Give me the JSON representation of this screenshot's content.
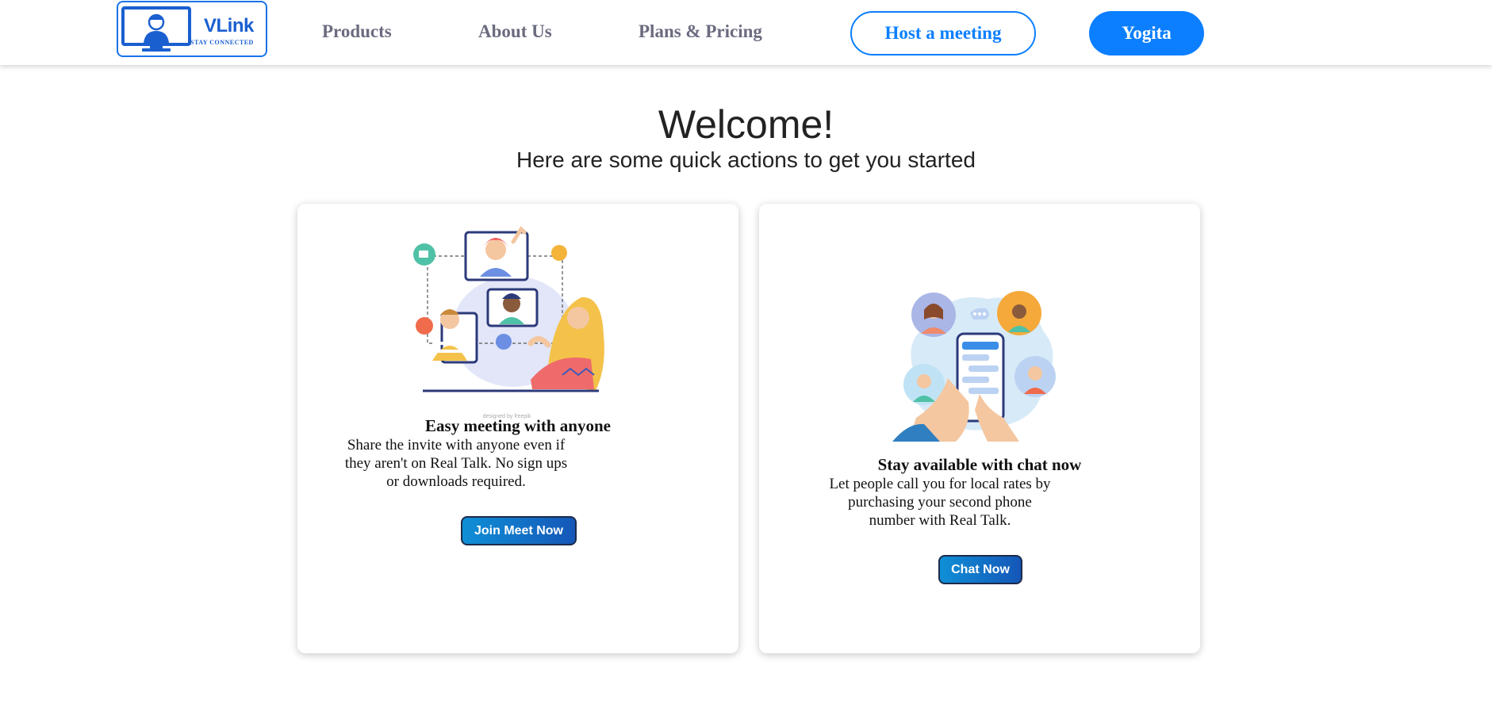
{
  "logo": {
    "name": "VLink",
    "tagline": "STAY CONNECTED"
  },
  "nav": {
    "links": [
      "Products",
      "About Us",
      "Plans & Pricing"
    ],
    "host_button": "Host a meeting",
    "user_button": "Yogita"
  },
  "hero": {
    "title": "Welcome!",
    "subtitle": "Here are some quick actions to get you started"
  },
  "cards": [
    {
      "title": "Easy meeting with anyone",
      "desc_lines": [
        "Share the invite with anyone even if",
        "they aren't on Real Talk. No sign ups",
        "or downloads required."
      ],
      "button": "Join Meet Now",
      "illustration": "video-meeting-illustration"
    },
    {
      "title": "Stay available with chat now",
      "desc_lines": [
        "Let people call you for local rates by",
        "purchasing your second phone",
        "number with Real Talk."
      ],
      "button": "Chat Now",
      "illustration": "phone-chat-illustration"
    }
  ],
  "colors": {
    "accent": "#0b7fff",
    "nav_text": "#6b6b80",
    "logo_blue": "#1a5fd0"
  }
}
